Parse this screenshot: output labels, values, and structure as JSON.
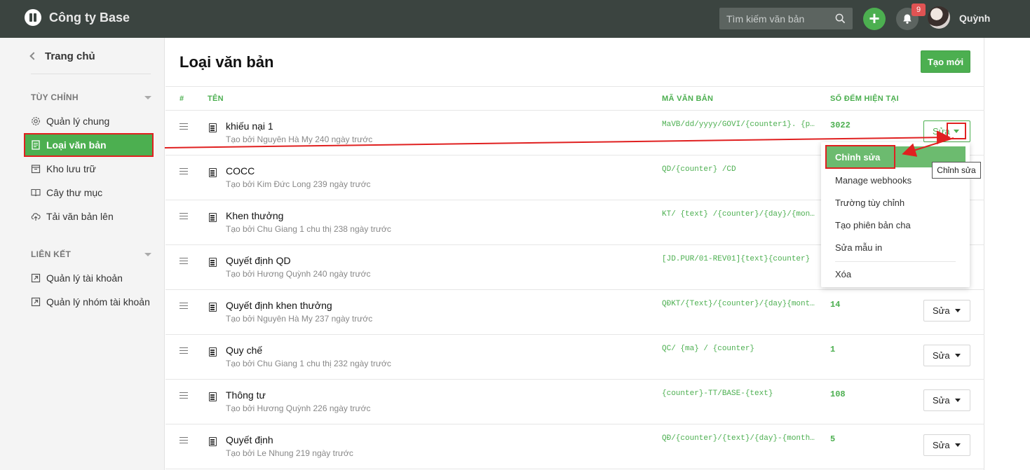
{
  "header": {
    "company": "Công ty Base",
    "search_placeholder": "Tìm kiếm văn bản",
    "add_label": "+",
    "notification_count": "9",
    "username": "Quỳnh"
  },
  "sidebar": {
    "home": "Trang chủ",
    "sections": [
      {
        "title": "TÙY CHỈNH",
        "items": [
          {
            "label": "Quản lý chung",
            "icon": "gear-icon"
          },
          {
            "label": "Loại văn bản",
            "icon": "document-icon",
            "active": true
          },
          {
            "label": "Kho lưu trữ",
            "icon": "archive-icon"
          },
          {
            "label": "Cây thư mục",
            "icon": "book-icon"
          },
          {
            "label": "Tải văn bản lên",
            "icon": "upload-cloud-icon"
          }
        ]
      },
      {
        "title": "LIÊN KẾT",
        "items": [
          {
            "label": "Quản lý tài khoản",
            "icon": "external-link-icon"
          },
          {
            "label": "Quản lý nhóm tài khoản",
            "icon": "external-link-icon"
          }
        ]
      }
    ]
  },
  "main": {
    "title": "Loại văn bản",
    "create_label": "Tạo mới",
    "columns": {
      "index": "#",
      "name": "TÊN",
      "code": "MÃ VĂN BẢN",
      "count": "SỐ ĐẾM HIỆN TẠI"
    },
    "edit_label": "Sửa",
    "rows": [
      {
        "name": "khiếu nại 1",
        "sub": "Tạo bởi Nguyên Hà My 240 ngày trước",
        "code": "MaVB/dd/yyyy/GOVI/{counter1}. {p...",
        "count": "3022"
      },
      {
        "name": "COCC",
        "sub": "Tạo bởi Kim Đức Long 239 ngày trước",
        "code": "QD/{counter} /CD",
        "count": ""
      },
      {
        "name": "Khen thưởng",
        "sub": "Tạo bởi Chu Giang 1 chu thị 238 ngày trước",
        "code": "KT/ {text} /{counter}/{day}/{mon...",
        "count": ""
      },
      {
        "name": "Quyết định QD",
        "sub": "Tạo bởi Hương Quỳnh 240 ngày trước",
        "code": "[JD.PUR/01-REV01]{text}{counter}",
        "count": ""
      },
      {
        "name": "Quyết định khen thưởng",
        "sub": "Tạo bởi Nguyên Hà My 237 ngày trước",
        "code": "QĐKT/{Text}/{counter}/{day}{mont...",
        "count": "14"
      },
      {
        "name": "Quy chế",
        "sub": "Tạo bởi Chu Giang 1 chu thị 232 ngày trước",
        "code": "QC/ {ma} / {counter}",
        "count": "1"
      },
      {
        "name": "Thông tư",
        "sub": "Tạo bởi Hương Quỳnh 226 ngày trước",
        "code": "{counter}-TT/BASE-{text}",
        "count": "108"
      },
      {
        "name": "Quyết định",
        "sub": "Tạo bởi Le Nhung 219 ngày trước",
        "code": "QĐ/{counter}/{text}/{day}-{month...",
        "count": "5"
      }
    ]
  },
  "dropdown": {
    "items": [
      "Chỉnh sửa",
      "Manage webhooks",
      "Trường tùy chỉnh",
      "Tạo phiên bản cha",
      "Sửa mẫu in",
      "Xóa"
    ],
    "tooltip": "Chỉnh sửa"
  },
  "colors": {
    "accent": "#4caf50",
    "topbar": "#3b4440",
    "annotation": "#e02020"
  }
}
